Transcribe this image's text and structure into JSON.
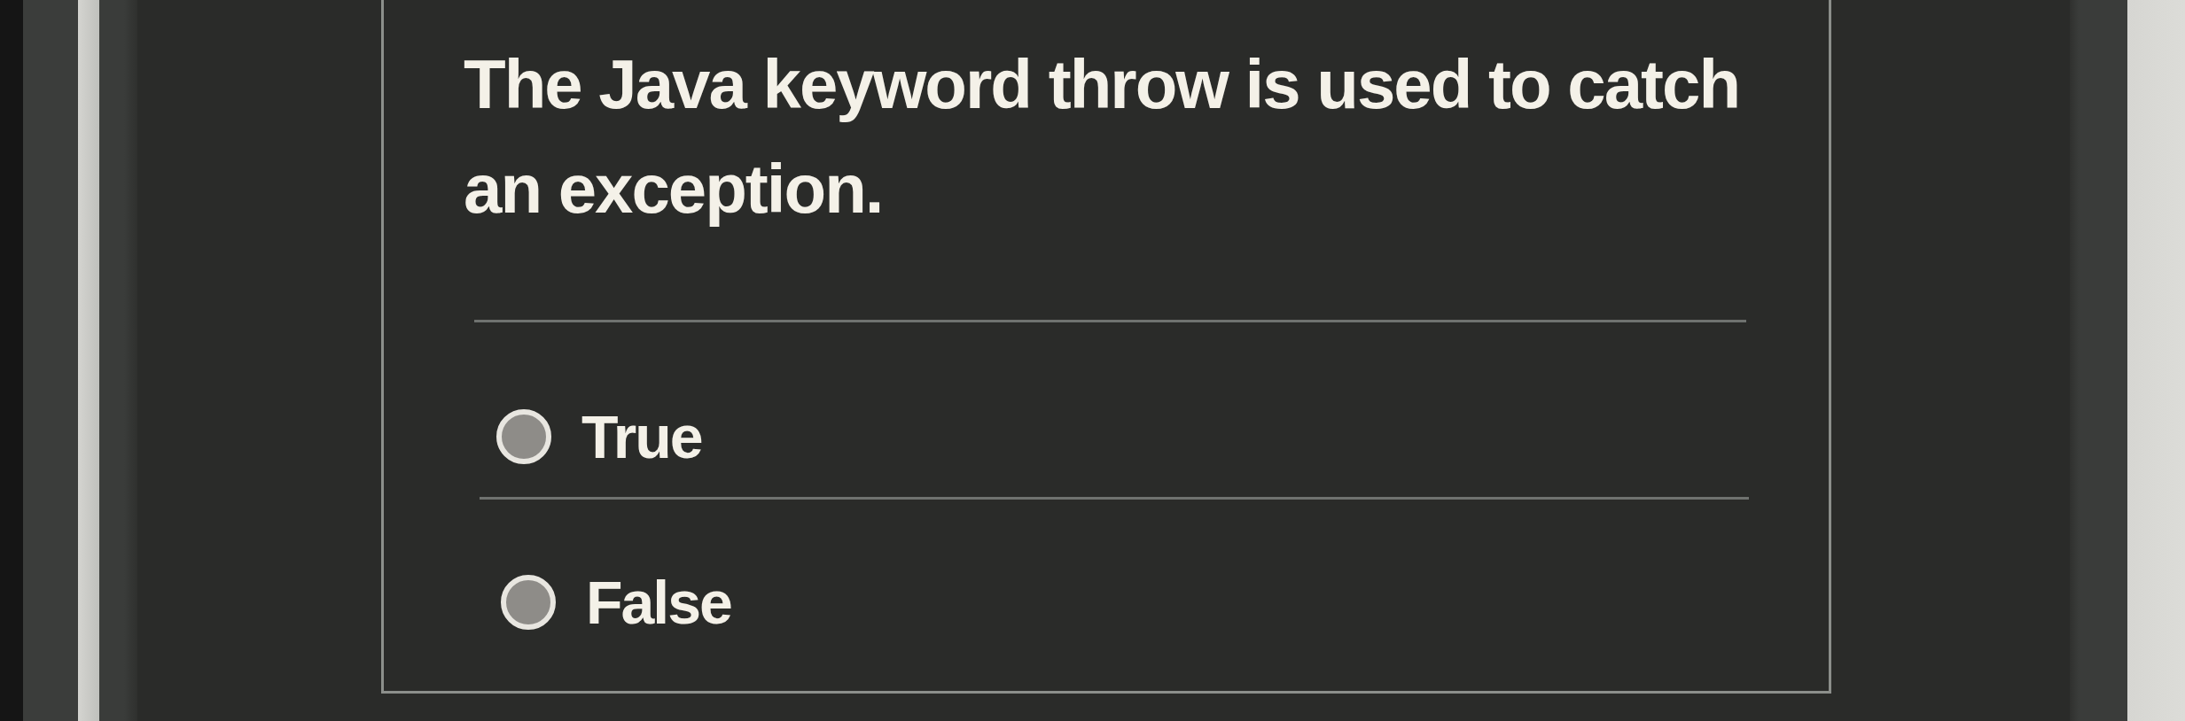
{
  "question": {
    "text": "The Java keyword throw is used to catch an exception."
  },
  "options": [
    {
      "label": "True",
      "selected": false
    },
    {
      "label": "False",
      "selected": false
    }
  ]
}
